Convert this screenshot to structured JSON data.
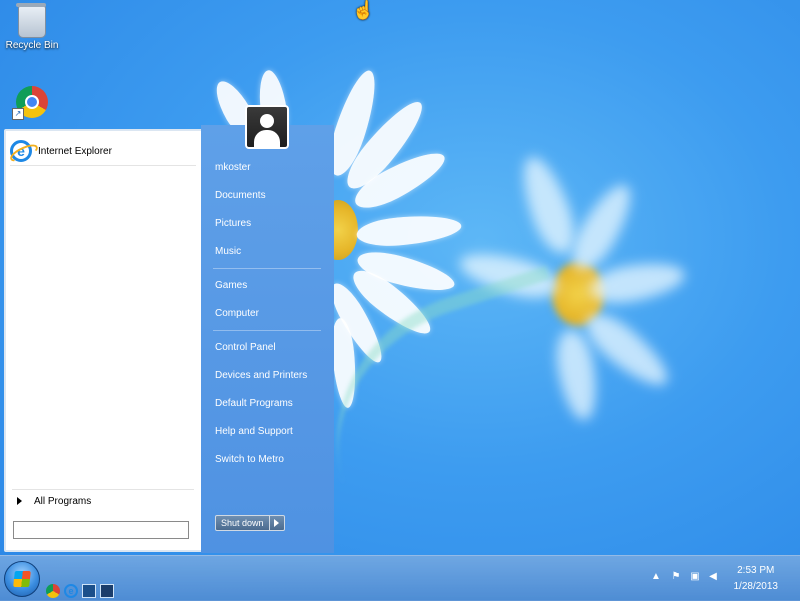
{
  "desktop": {
    "icons": [
      {
        "label": "Recycle Bin",
        "icon": "recycle-bin-icon"
      },
      {
        "label": "",
        "icon": "chrome-icon"
      }
    ]
  },
  "start_menu": {
    "pinned": [
      {
        "label": "Internet Explorer",
        "icon": "internet-explorer-icon"
      }
    ],
    "all_programs_label": "All Programs",
    "search_value": "",
    "user_name": "mkoster",
    "right_items_group1": [
      "Documents",
      "Pictures",
      "Music"
    ],
    "right_items_group2": [
      "Games",
      "Computer"
    ],
    "right_items_group3": [
      "Control Panel",
      "Devices and Printers",
      "Default Programs",
      "Help and Support",
      "Switch to Metro"
    ],
    "shutdown_label": "Shut down"
  },
  "taskbar": {
    "pinned_icons": [
      "chrome-icon",
      "internet-explorer-icon",
      "remote-desktop-icon",
      "window-switch-icon"
    ],
    "tray_icons": [
      "network-icon",
      "flag-icon",
      "display-icon",
      "volume-icon"
    ],
    "time": "2:53 PM",
    "date": "1/28/2013"
  },
  "colors": {
    "start_right_pane": "#5a9ae6",
    "wallpaper": "#3d9cf0"
  }
}
